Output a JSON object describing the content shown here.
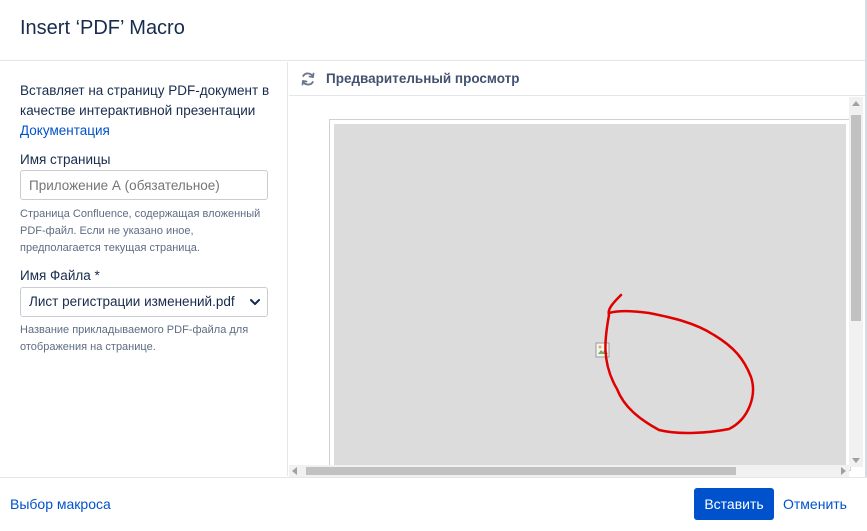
{
  "dialog": {
    "title": "Insert ‘PDF’ Macro"
  },
  "left_panel": {
    "description": "Вставляет на страницу PDF-документ в качестве интерактивной презентации",
    "doc_link": "Документация",
    "page_field": {
      "label": "Имя страницы",
      "placeholder": "Приложение А (обязательное)",
      "help": "Страница Confluence, содержащая вложенный PDF-файл. Если не указано иное, предполагается текущая страница."
    },
    "file_field": {
      "label": "Имя Файла *",
      "selected": "Лист регистрации изменений.pdf",
      "help": "Название прикладываемого PDF-файла для отображения на странице."
    }
  },
  "preview": {
    "title": "Предварительный просмотр",
    "refresh_icon": "refresh-icon",
    "annotation_color": "#e00000"
  },
  "footer": {
    "select_macro": "Выбор макроса",
    "insert": "Вставить",
    "cancel": "Отменить"
  },
  "colors": {
    "accent": "#0052cc",
    "text": "#172b4d",
    "muted": "#5e6c84"
  }
}
